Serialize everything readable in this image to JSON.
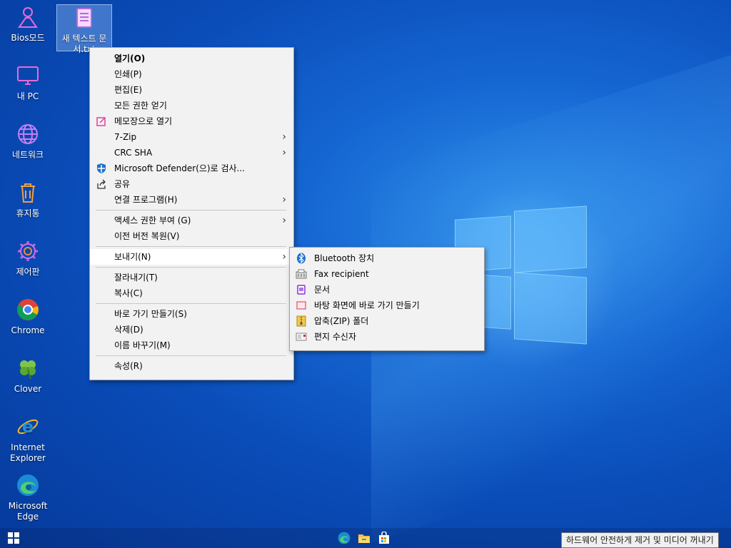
{
  "desktop": {
    "icons": [
      {
        "label": "Bios모드",
        "icon": "person-icon"
      },
      {
        "label": "새 텍스트 문서.txt",
        "icon": "text-file-icon"
      },
      {
        "label": "내 PC",
        "icon": "monitor-icon"
      },
      {
        "label": "네트워크",
        "icon": "globe-icon"
      },
      {
        "label": "휴지통",
        "icon": "recycle-bin-icon"
      },
      {
        "label": "제어판",
        "icon": "gear-icon"
      },
      {
        "label": "Chrome",
        "icon": "chrome-icon"
      },
      {
        "label": "Clover",
        "icon": "clover-icon"
      },
      {
        "label": "Internet Explorer",
        "icon": "ie-icon"
      },
      {
        "label": "Microsoft Edge",
        "icon": "edge-icon"
      }
    ]
  },
  "context_menu": {
    "items": [
      {
        "label": "열기(O)"
      },
      {
        "label": "인쇄(P)"
      },
      {
        "label": "편집(E)"
      },
      {
        "label": "모든 권한 얻기"
      },
      {
        "label": "메모장으로 열기",
        "icon": "notepad-icon"
      },
      {
        "label": "7-Zip"
      },
      {
        "label": "CRC SHA"
      },
      {
        "label": "Microsoft Defender(으)로 검사...",
        "icon": "defender-shield-icon"
      },
      {
        "label": "공유",
        "icon": "share-icon"
      },
      {
        "label": "연결 프로그램(H)"
      },
      {
        "label": "액세스 권한 부여 (G)"
      },
      {
        "label": "이전 버전 복원(V)"
      },
      {
        "label": "보내기(N)"
      },
      {
        "label": "잘라내기(T)"
      },
      {
        "label": "복사(C)"
      },
      {
        "label": "바로 가기 만들기(S)"
      },
      {
        "label": "삭제(D)"
      },
      {
        "label": "이름 바꾸기(M)"
      },
      {
        "label": "속성(R)"
      }
    ]
  },
  "sendto_menu": {
    "items": [
      {
        "label": "Bluetooth 장치",
        "icon": "bluetooth-icon"
      },
      {
        "label": "Fax recipient",
        "icon": "fax-icon"
      },
      {
        "label": "문서",
        "icon": "documents-icon"
      },
      {
        "label": "바탕 화면에 바로 가기 만들기",
        "icon": "desktop-shortcut-icon"
      },
      {
        "label": "압축(ZIP) 폴더",
        "icon": "zip-folder-icon"
      },
      {
        "label": "편지 수신자",
        "icon": "mail-recipient-icon"
      }
    ]
  },
  "taskbar": {
    "start": "windows-start-icon",
    "pinned": [
      "edge-icon",
      "file-explorer-icon",
      "store-icon"
    ]
  },
  "tooltip": {
    "text": "하드웨어 안전하게 제거 및 미디어 꺼내기"
  },
  "colors": {
    "accent": "#0a5bd0",
    "menu_bg": "#f2f2f2"
  }
}
